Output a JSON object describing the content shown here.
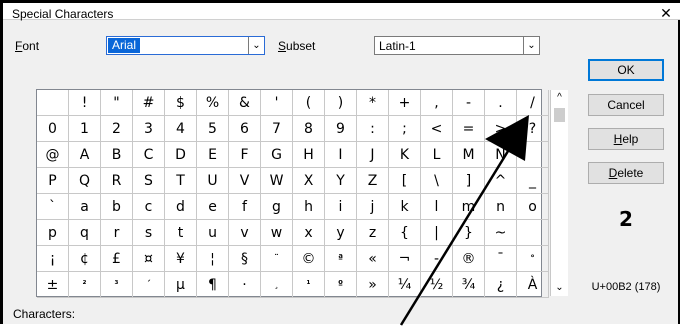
{
  "window": {
    "title": "Special Characters",
    "close_glyph": "✕"
  },
  "font": {
    "label_u": "F",
    "label_rest": "ont",
    "value": "Arial"
  },
  "subset": {
    "label_u": "S",
    "label_rest": "ubset",
    "value": "Latin-1"
  },
  "grid_rows": [
    [
      "",
      "!",
      "\"",
      "#",
      "$",
      "%",
      "&",
      "'",
      "(",
      ")",
      "*",
      "+",
      ",",
      "-",
      ".",
      "/"
    ],
    [
      "0",
      "1",
      "2",
      "3",
      "4",
      "5",
      "6",
      "7",
      "8",
      "9",
      ":",
      ";",
      "<",
      "=",
      ">",
      "?"
    ],
    [
      "@",
      "A",
      "B",
      "C",
      "D",
      "E",
      "F",
      "G",
      "H",
      "I",
      "J",
      "K",
      "L",
      "M",
      "N",
      ""
    ],
    [
      "P",
      "Q",
      "R",
      "S",
      "T",
      "U",
      "V",
      "W",
      "X",
      "Y",
      "Z",
      "[",
      "\\",
      "]",
      "^",
      "_"
    ],
    [
      "`",
      "a",
      "b",
      "c",
      "d",
      "e",
      "f",
      "g",
      "h",
      "i",
      "j",
      "k",
      "l",
      "m",
      "n",
      "o"
    ],
    [
      "p",
      "q",
      "r",
      "s",
      "t",
      "u",
      "v",
      "w",
      "x",
      "y",
      "z",
      "{",
      "|",
      "}",
      "~",
      ""
    ],
    [
      "¡",
      "¢",
      "£",
      "¤",
      "¥",
      "¦",
      "§",
      "¨",
      "©",
      "ª",
      "«",
      "¬",
      "-",
      "®",
      "¯",
      "°"
    ],
    [
      "±",
      "²",
      "³",
      "´",
      "µ",
      "¶",
      "·",
      "¸",
      "¹",
      "º",
      "»",
      "¼",
      "½",
      "¾",
      "¿",
      "À"
    ]
  ],
  "small_glyphs": [
    "²",
    "³",
    "¹",
    "º",
    "ª",
    "°",
    "´",
    "¸",
    "¨"
  ],
  "scrollbar": {
    "up_glyph": "^",
    "down_glyph": "⌄"
  },
  "buttons": {
    "ok": "OK",
    "cancel": "Cancel",
    "help_u": "H",
    "help_rest": "elp",
    "delete_u": "D",
    "delete_rest": "elete"
  },
  "preview_char": "2",
  "code": "U+00B2 (178)",
  "characters_label": "Characters:"
}
